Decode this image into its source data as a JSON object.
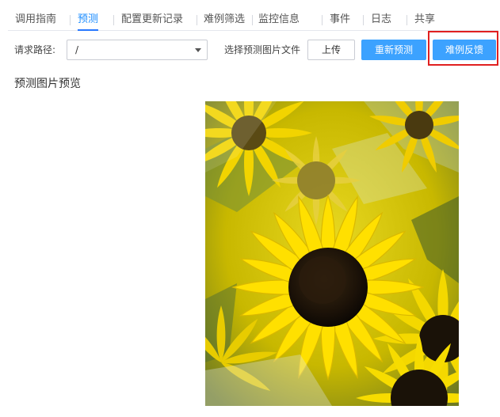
{
  "tabs": [
    {
      "label": "调用指南",
      "active": false
    },
    {
      "label": "预测",
      "active": true
    },
    {
      "label": "配置更新记录",
      "active": false
    },
    {
      "label": "难例筛选",
      "active": false
    },
    {
      "label": "监控信息",
      "active": false
    },
    {
      "label": "事件",
      "active": false
    },
    {
      "label": "日志",
      "active": false
    },
    {
      "label": "共享",
      "active": false
    }
  ],
  "request": {
    "label": "请求路径:",
    "path_value": "/",
    "file_label": "选择预测图片文件"
  },
  "buttons": {
    "upload": "上传",
    "repredict": "重新预测",
    "hard_example_feedback": "难例反馈"
  },
  "preview": {
    "title": "预测图片预览"
  },
  "colors": {
    "accent": "#3ca2ff",
    "active_tab": "#1a8cff",
    "highlight": "#e02020"
  }
}
